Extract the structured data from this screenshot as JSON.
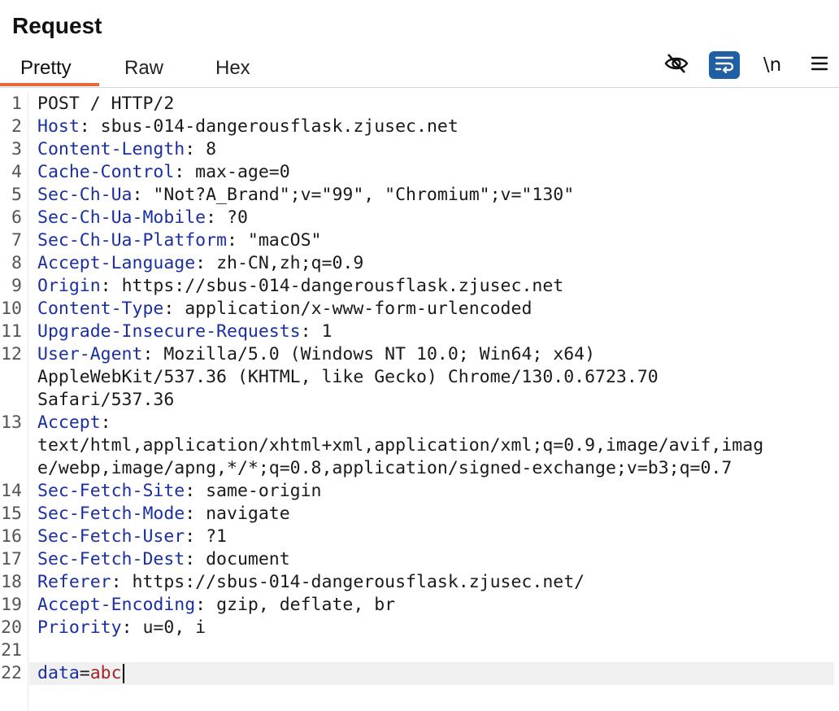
{
  "panel": {
    "title": "Request"
  },
  "tabs": [
    {
      "label": "Pretty",
      "active": true
    },
    {
      "label": "Raw",
      "active": false
    },
    {
      "label": "Hex",
      "active": false
    }
  ],
  "toolbar": {
    "hide_icon": "eye-slash-icon",
    "wrap_icon": "wrap-lines-icon",
    "newline_label": "\\n",
    "menu_icon": "hamburger-menu-icon",
    "accent_color": "#1f5fa3",
    "tab_accent_color": "#e8663c"
  },
  "request": {
    "request_line": "POST / HTTP/2",
    "headers": [
      {
        "n": "2",
        "name": "Host",
        "value": "sbus-014-dangerousflask.zjusec.net"
      },
      {
        "n": "3",
        "name": "Content-Length",
        "value": "8"
      },
      {
        "n": "4",
        "name": "Cache-Control",
        "value": "max-age=0"
      },
      {
        "n": "5",
        "name": "Sec-Ch-Ua",
        "value": "\"Not?A_Brand\";v=\"99\", \"Chromium\";v=\"130\""
      },
      {
        "n": "6",
        "name": "Sec-Ch-Ua-Mobile",
        "value": "?0"
      },
      {
        "n": "7",
        "name": "Sec-Ch-Ua-Platform",
        "value": "\"macOS\""
      },
      {
        "n": "8",
        "name": "Accept-Language",
        "value": "zh-CN,zh;q=0.9"
      },
      {
        "n": "9",
        "name": "Origin",
        "value": "https://sbus-014-dangerousflask.zjusec.net"
      },
      {
        "n": "10",
        "name": "Content-Type",
        "value": "application/x-www-form-urlencoded"
      },
      {
        "n": "11",
        "name": "Upgrade-Insecure-Requests",
        "value": "1"
      },
      {
        "n": "12",
        "name": "User-Agent",
        "value": "Mozilla/5.0 (Windows NT 10.0; Win64; x64)"
      },
      {
        "n": "13",
        "name": "Accept",
        "value": ""
      },
      {
        "n": "14",
        "name": "Sec-Fetch-Site",
        "value": "same-origin"
      },
      {
        "n": "15",
        "name": "Sec-Fetch-Mode",
        "value": "navigate"
      },
      {
        "n": "16",
        "name": "Sec-Fetch-User",
        "value": "?1"
      },
      {
        "n": "17",
        "name": "Sec-Fetch-Dest",
        "value": "document"
      },
      {
        "n": "18",
        "name": "Referer",
        "value": "https://sbus-014-dangerousflask.zjusec.net/"
      },
      {
        "n": "19",
        "name": "Accept-Encoding",
        "value": "gzip, deflate, br"
      },
      {
        "n": "20",
        "name": "Priority",
        "value": "u=0, i"
      }
    ],
    "user_agent_cont": [
      "AppleWebKit/537.36 (KHTML, like Gecko) Chrome/130.0.6723.70",
      "Safari/537.36"
    ],
    "accept_cont": [
      "text/html,application/xhtml+xml,application/xml;q=0.9,image/avif,imag",
      "e/webp,image/apng,*/*;q=0.8,application/signed-exchange;v=b3;q=0.7"
    ],
    "line_numbers": {
      "first": "1",
      "blank": "21",
      "body": "22"
    },
    "body": {
      "key": "data",
      "eq": "=",
      "value": "abc"
    }
  }
}
